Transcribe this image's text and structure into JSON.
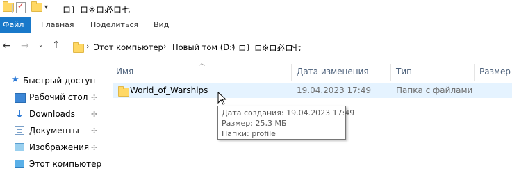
{
  "titlebar": {
    "title": "ロ〕ロ※ロ必ロ七",
    "icons": [
      "folder-icon",
      "properties-icon",
      "new-folder-icon",
      "dropdown-arrow-icon"
    ]
  },
  "ribbon": {
    "tabs": [
      {
        "label": "Файл",
        "active": true
      },
      {
        "label": "Главная"
      },
      {
        "label": "Поделиться"
      },
      {
        "label": "Вид"
      }
    ]
  },
  "address": {
    "breadcrumbs": [
      "Этот компьютер",
      "Новый том (D:)",
      "ロ〕ロ※ロ必ロ七"
    ]
  },
  "sidebar": {
    "items": [
      {
        "label": "Быстрый доступ",
        "icon": "star-icon"
      },
      {
        "label": "Рабочий стол",
        "icon": "desktop-icon",
        "pinned": true
      },
      {
        "label": "Downloads",
        "icon": "download-icon",
        "pinned": true
      },
      {
        "label": "Документы",
        "icon": "documents-icon",
        "pinned": true
      },
      {
        "label": "Изображения",
        "icon": "pictures-icon",
        "pinned": true
      },
      {
        "label": "Этот компьютер",
        "icon": "computer-icon"
      }
    ]
  },
  "filelist": {
    "columns": [
      "Имя",
      "Дата изменения",
      "Тип",
      "Размер"
    ],
    "rows": [
      {
        "name": "World_of_Warships",
        "date": "19.04.2023 17:49",
        "type": "Папка с файлами",
        "size": ""
      }
    ]
  },
  "tooltip": {
    "lines": [
      "Дата создания: 19.04.2023 17:49",
      "Размер: 25,3 МБ",
      "Папки: profile"
    ]
  },
  "colors": {
    "accent": "#1979ca",
    "selection": "#e5f3ff",
    "folder": "#ffd865"
  }
}
